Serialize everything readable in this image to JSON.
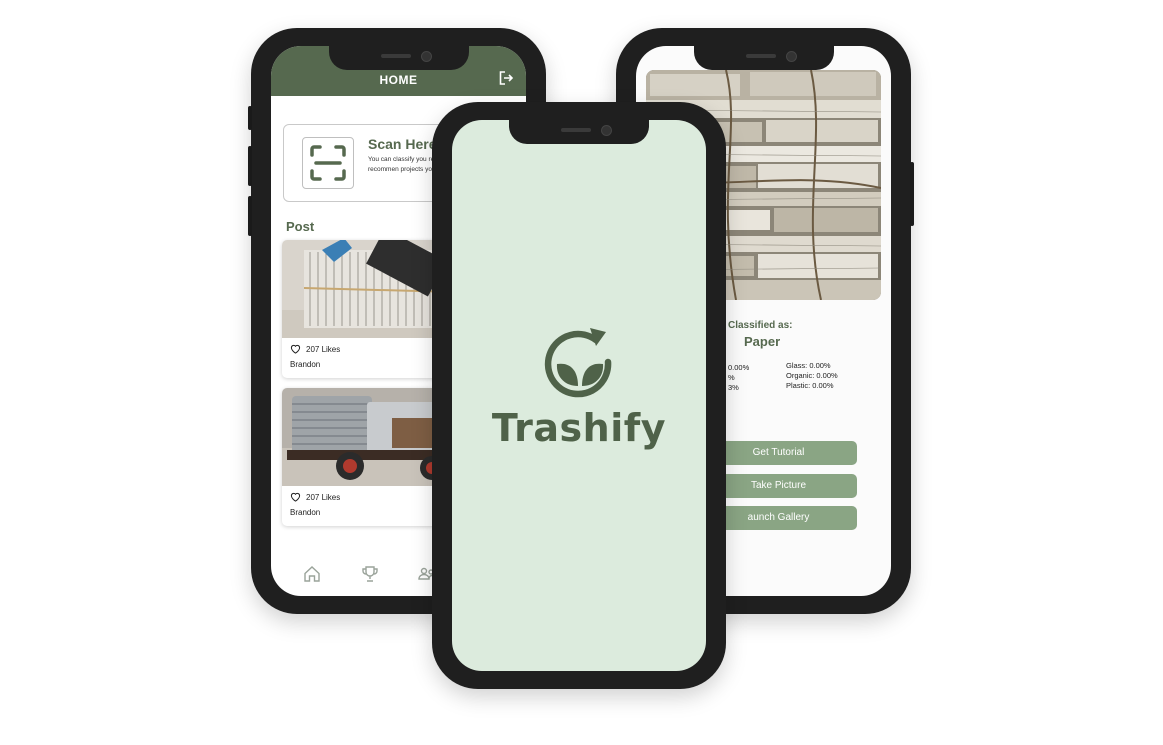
{
  "colors": {
    "primary_green": "#56694f",
    "button_green": "#8aa584",
    "splash_bg": "#dcebdd",
    "phone_frame": "#1f1f1f"
  },
  "home": {
    "title": "HOME",
    "logout_icon": "logout-icon",
    "scan": {
      "title": "Scan Here",
      "description": "You can classify you receive recommen projects you can m"
    },
    "post_label": "Post",
    "posts": [
      {
        "likes": "207 Likes",
        "author": "Brandon"
      },
      {
        "likes": "207 Likes",
        "author": "Brandon"
      }
    ],
    "nav_icons": [
      "home-icon",
      "trophy-icon",
      "community-icon"
    ]
  },
  "splash": {
    "brand": "Trashify"
  },
  "classify": {
    "classified_label": "Classified as:",
    "classified_value": "Paper",
    "left_column": [
      "0.00%",
      "%",
      "3%"
    ],
    "right_column": [
      "Glass: 0.00%",
      "Organic: 0.00%",
      "Plastic: 0.00%"
    ],
    "buttons": [
      "Get Tutorial",
      "Take Picture",
      "aunch Gallery"
    ]
  }
}
